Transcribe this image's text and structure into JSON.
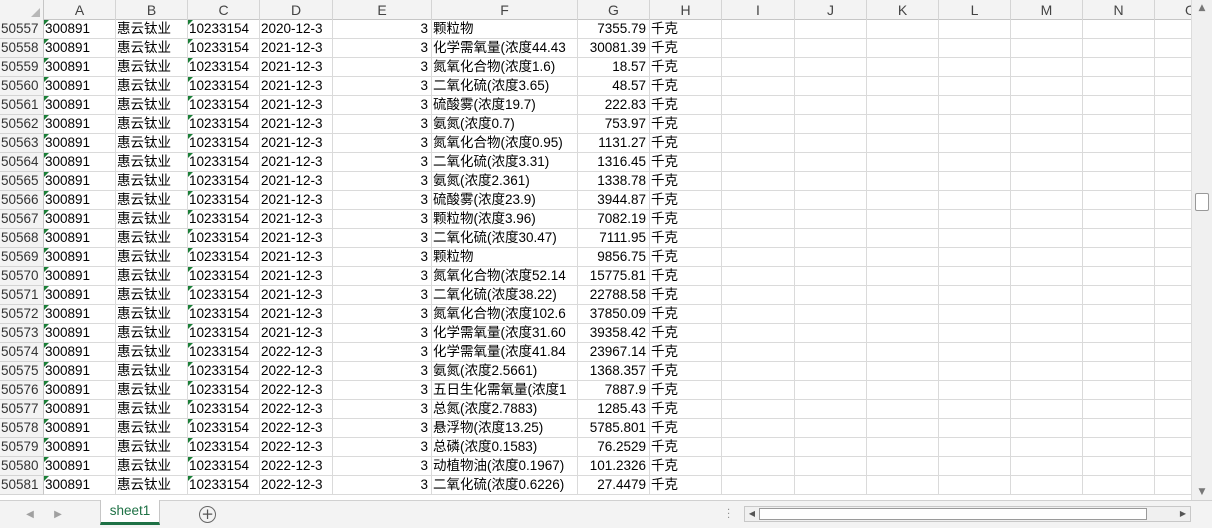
{
  "columns": [
    "A",
    "B",
    "C",
    "D",
    "E",
    "F",
    "G",
    "H",
    "I",
    "J",
    "K",
    "L",
    "M",
    "N",
    "O"
  ],
  "rows": [
    {
      "n": "50557",
      "a": "300891",
      "b": "惠云钛业",
      "c": "10233154",
      "d": "2020-12-3",
      "e": "3",
      "f": "颗粒物",
      "g": "7355.79",
      "h": "千克"
    },
    {
      "n": "50558",
      "a": "300891",
      "b": "惠云钛业",
      "c": "10233154",
      "d": "2021-12-3",
      "e": "3",
      "f": "化学需氧量(浓度44.43",
      "g": "30081.39",
      "h": "千克"
    },
    {
      "n": "50559",
      "a": "300891",
      "b": "惠云钛业",
      "c": "10233154",
      "d": "2021-12-3",
      "e": "3",
      "f": "氮氧化合物(浓度1.6)",
      "g": "18.57",
      "h": "千克"
    },
    {
      "n": "50560",
      "a": "300891",
      "b": "惠云钛业",
      "c": "10233154",
      "d": "2021-12-3",
      "e": "3",
      "f": "二氧化硫(浓度3.65)",
      "g": "48.57",
      "h": "千克"
    },
    {
      "n": "50561",
      "a": "300891",
      "b": "惠云钛业",
      "c": "10233154",
      "d": "2021-12-3",
      "e": "3",
      "f": "硫酸雾(浓度19.7)",
      "g": "222.83",
      "h": "千克"
    },
    {
      "n": "50562",
      "a": "300891",
      "b": "惠云钛业",
      "c": "10233154",
      "d": "2021-12-3",
      "e": "3",
      "f": "氨氮(浓度0.7)",
      "g": "753.97",
      "h": "千克"
    },
    {
      "n": "50563",
      "a": "300891",
      "b": "惠云钛业",
      "c": "10233154",
      "d": "2021-12-3",
      "e": "3",
      "f": "氮氧化合物(浓度0.95)",
      "g": "1131.27",
      "h": "千克"
    },
    {
      "n": "50564",
      "a": "300891",
      "b": "惠云钛业",
      "c": "10233154",
      "d": "2021-12-3",
      "e": "3",
      "f": "二氧化硫(浓度3.31)",
      "g": "1316.45",
      "h": "千克"
    },
    {
      "n": "50565",
      "a": "300891",
      "b": "惠云钛业",
      "c": "10233154",
      "d": "2021-12-3",
      "e": "3",
      "f": "氨氮(浓度2.361)",
      "g": "1338.78",
      "h": "千克"
    },
    {
      "n": "50566",
      "a": "300891",
      "b": "惠云钛业",
      "c": "10233154",
      "d": "2021-12-3",
      "e": "3",
      "f": "硫酸雾(浓度23.9)",
      "g": "3944.87",
      "h": "千克"
    },
    {
      "n": "50567",
      "a": "300891",
      "b": "惠云钛业",
      "c": "10233154",
      "d": "2021-12-3",
      "e": "3",
      "f": "颗粒物(浓度3.96)",
      "g": "7082.19",
      "h": "千克"
    },
    {
      "n": "50568",
      "a": "300891",
      "b": "惠云钛业",
      "c": "10233154",
      "d": "2021-12-3",
      "e": "3",
      "f": "二氧化硫(浓度30.47)",
      "g": "7111.95",
      "h": "千克"
    },
    {
      "n": "50569",
      "a": "300891",
      "b": "惠云钛业",
      "c": "10233154",
      "d": "2021-12-3",
      "e": "3",
      "f": "颗粒物",
      "g": "9856.75",
      "h": "千克"
    },
    {
      "n": "50570",
      "a": "300891",
      "b": "惠云钛业",
      "c": "10233154",
      "d": "2021-12-3",
      "e": "3",
      "f": "氮氧化合物(浓度52.14",
      "g": "15775.81",
      "h": "千克"
    },
    {
      "n": "50571",
      "a": "300891",
      "b": "惠云钛业",
      "c": "10233154",
      "d": "2021-12-3",
      "e": "3",
      "f": "二氧化硫(浓度38.22)",
      "g": "22788.58",
      "h": "千克"
    },
    {
      "n": "50572",
      "a": "300891",
      "b": "惠云钛业",
      "c": "10233154",
      "d": "2021-12-3",
      "e": "3",
      "f": "氮氧化合物(浓度102.6",
      "g": "37850.09",
      "h": "千克"
    },
    {
      "n": "50573",
      "a": "300891",
      "b": "惠云钛业",
      "c": "10233154",
      "d": "2021-12-3",
      "e": "3",
      "f": "化学需氧量(浓度31.60",
      "g": "39358.42",
      "h": "千克"
    },
    {
      "n": "50574",
      "a": "300891",
      "b": "惠云钛业",
      "c": "10233154",
      "d": "2022-12-3",
      "e": "3",
      "f": "化学需氧量(浓度41.84",
      "g": "23967.14",
      "h": "千克"
    },
    {
      "n": "50575",
      "a": "300891",
      "b": "惠云钛业",
      "c": "10233154",
      "d": "2022-12-3",
      "e": "3",
      "f": "氨氮(浓度2.5661)",
      "g": "1368.357",
      "h": "千克"
    },
    {
      "n": "50576",
      "a": "300891",
      "b": "惠云钛业",
      "c": "10233154",
      "d": "2022-12-3",
      "e": "3",
      "f": "五日生化需氧量(浓度1",
      "g": "7887.9",
      "h": "千克"
    },
    {
      "n": "50577",
      "a": "300891",
      "b": "惠云钛业",
      "c": "10233154",
      "d": "2022-12-3",
      "e": "3",
      "f": "总氮(浓度2.7883)",
      "g": "1285.43",
      "h": "千克"
    },
    {
      "n": "50578",
      "a": "300891",
      "b": "惠云钛业",
      "c": "10233154",
      "d": "2022-12-3",
      "e": "3",
      "f": "悬浮物(浓度13.25)",
      "g": "5785.801",
      "h": "千克"
    },
    {
      "n": "50579",
      "a": "300891",
      "b": "惠云钛业",
      "c": "10233154",
      "d": "2022-12-3",
      "e": "3",
      "f": "总磷(浓度0.1583)",
      "g": "76.2529",
      "h": "千克"
    },
    {
      "n": "50580",
      "a": "300891",
      "b": "惠云钛业",
      "c": "10233154",
      "d": "2022-12-3",
      "e": "3",
      "f": "动植物油(浓度0.1967)",
      "g": "101.2326",
      "h": "千克"
    },
    {
      "n": "50581",
      "a": "300891",
      "b": "惠云钛业",
      "c": "10233154",
      "d": "2022-12-3",
      "e": "3",
      "f": "二氧化硫(浓度0.6226)",
      "g": "27.4479",
      "h": "千克"
    }
  ],
  "sheet_tab": "sheet1",
  "icons": {
    "add_sheet": "plus-circle-icon",
    "scroll_up": "triangle-up-icon",
    "scroll_down": "triangle-down-icon"
  },
  "colors": {
    "tab_accent": "#1e7145",
    "text_indicator": "#1a7f37"
  }
}
